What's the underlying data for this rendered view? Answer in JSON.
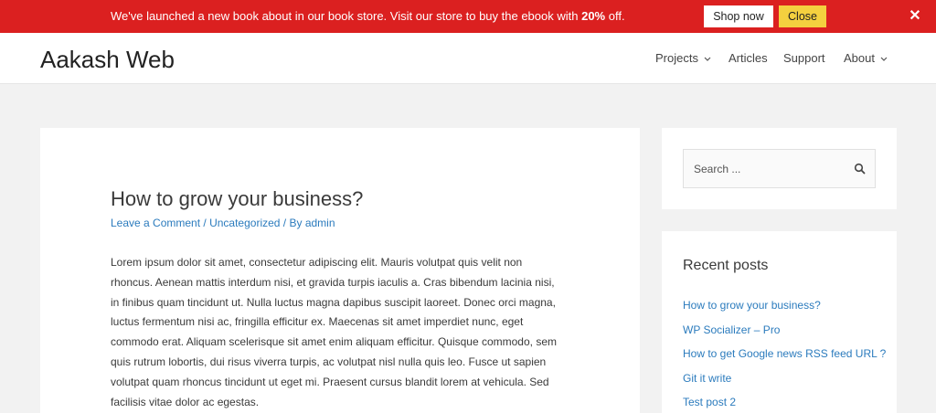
{
  "promo": {
    "text_before": "We've launched a new book about in our book store. Visit our store to buy the ebook with ",
    "text_bold": "20%",
    "text_after": " off.",
    "shop_label": "Shop now",
    "close_label": "Close",
    "dismiss_glyph": "✕",
    "colors": {
      "background": "#db2020",
      "close_button": "#f4d03f"
    }
  },
  "header": {
    "site_title": "Aakash Web",
    "nav": [
      {
        "label": "Projects",
        "has_dropdown": true
      },
      {
        "label": "Articles",
        "has_dropdown": false
      },
      {
        "label": "Support",
        "has_dropdown": false
      },
      {
        "label": "About",
        "has_dropdown": true
      }
    ]
  },
  "article": {
    "title": "How to grow your business?",
    "meta": {
      "comments": "Leave a Comment",
      "sep1": " / ",
      "category": "Uncategorized",
      "sep2": " / By ",
      "author": "admin"
    },
    "body": "Lorem ipsum dolor sit amet, consectetur adipiscing elit. Mauris volutpat quis velit non rhoncus. Aenean mattis interdum nisi, et gravida turpis iaculis a. Cras bibendum lacinia nisi, in finibus quam tincidunt ut. Nulla luctus magna dapibus suscipit laoreet. Donec orci magna, luctus fermentum nisi ac, fringilla efficitur ex. Maecenas sit amet imperdiet nunc, eget commodo erat. Aliquam scelerisque sit amet enim aliquam efficitur. Quisque commodo, sem quis rutrum lobortis, dui risus viverra turpis, ac volutpat nisl nulla quis leo. Fusce ut sapien volutpat quam rhoncus tincidunt ut eget mi. Praesent cursus blandit lorem at vehicula. Sed facilisis vitae dolor ac egestas."
  },
  "sidebar": {
    "search": {
      "placeholder": "Search ...",
      "value": "",
      "icon": "search-icon"
    },
    "recent": {
      "title": "Recent posts",
      "items": [
        "How to grow your business?",
        "WP Socializer – Pro",
        "How to get Google news RSS feed URL ?",
        "Git it write",
        "Test post 2"
      ]
    }
  },
  "colors": {
    "link": "#2b7bbd",
    "page_bg": "#f2f2f2",
    "text": "#3a3a3a"
  }
}
